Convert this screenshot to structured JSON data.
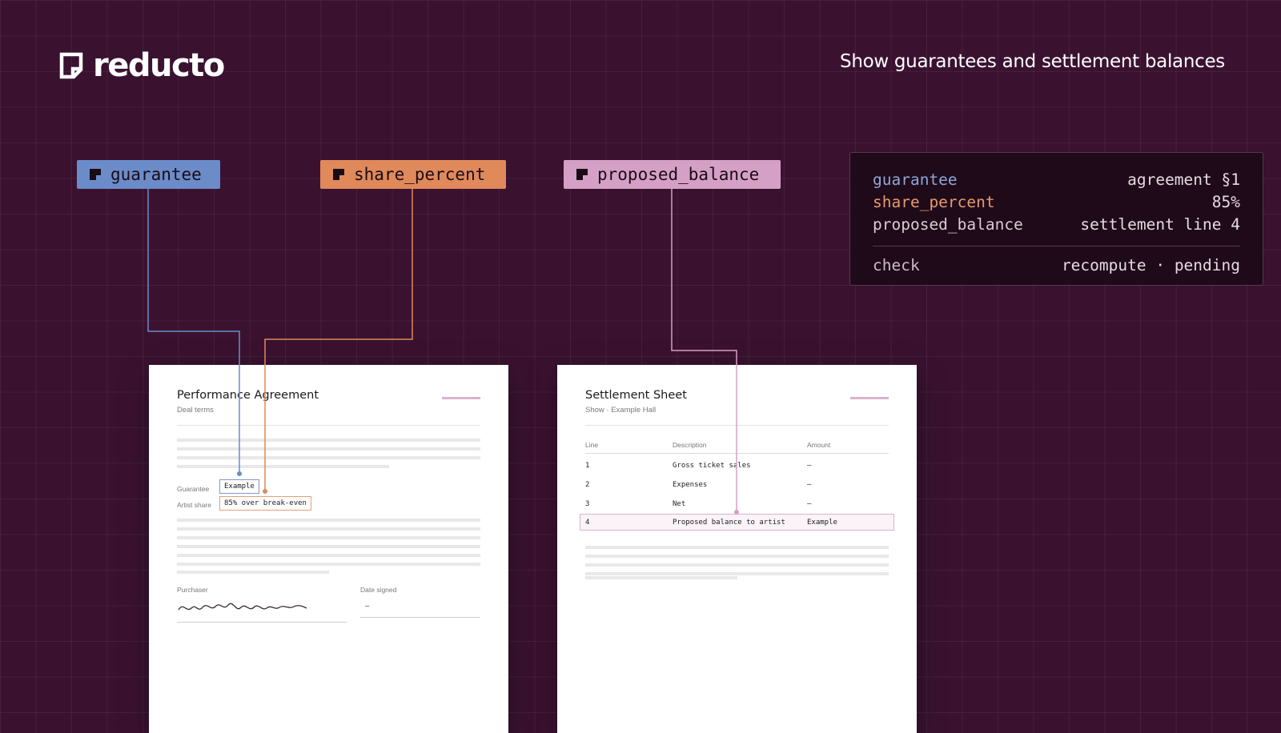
{
  "brand": {
    "name": "reducto",
    "icon": "reducto-logo-icon"
  },
  "tagline": "Show guarantees and settlement balances",
  "chips": [
    {
      "label": "guarantee",
      "color": "#6b8cc9"
    },
    {
      "label": "share_percent",
      "color": "#e0895a"
    },
    {
      "label": "proposed_balance",
      "color": "#d5a0c6"
    }
  ],
  "panel": {
    "rows": [
      {
        "key": "guarantee",
        "value": "agreement §1"
      },
      {
        "key": "share_percent",
        "value": "85%"
      },
      {
        "key": "proposed_balance",
        "value": "settlement line 4"
      }
    ],
    "check": {
      "key": "check",
      "value": "recompute · pending"
    }
  },
  "agreement": {
    "title": "Performance Agreement",
    "subtitle": "Deal terms",
    "fields": [
      {
        "label": "Guarantee",
        "value": "Example"
      },
      {
        "label": "Artist share",
        "value": "85% over break-even"
      }
    ],
    "signatures": {
      "purchaser_label": "Purchaser",
      "date_label": "Date signed",
      "date_value": "–"
    }
  },
  "settlement": {
    "title": "Settlement Sheet",
    "subtitle": "Show · Example Hall",
    "columns": [
      "Line",
      "Description",
      "Amount"
    ],
    "rows": [
      {
        "line": "1",
        "description": "Gross ticket sales",
        "amount": "–"
      },
      {
        "line": "2",
        "description": "Expenses",
        "amount": "–"
      },
      {
        "line": "3",
        "description": "Net",
        "amount": "–"
      },
      {
        "line": "4",
        "description": "Proposed balance to artist",
        "amount": "Example"
      }
    ]
  },
  "colors": {
    "background": "#3a1230",
    "blue": "#6b8cc9",
    "orange": "#e0895a",
    "pink": "#d5a0c6"
  }
}
